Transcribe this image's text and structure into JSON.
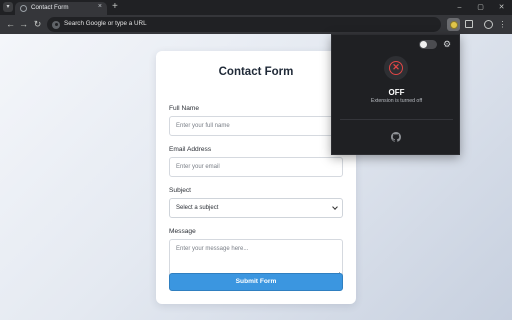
{
  "browser": {
    "tab_title": "Contact Form",
    "tab_close": "×",
    "new_tab": "+",
    "omnibox_placeholder": "Search Google or type a URL",
    "window_controls": {
      "minimize": "–",
      "maximize": "▢",
      "close": "✕"
    },
    "nav": {
      "back": "←",
      "forward": "→",
      "reload": "↻"
    },
    "menu": "⋮"
  },
  "form": {
    "title": "Contact Form",
    "full_name_label": "Full Name",
    "full_name_placeholder": "Enter your full name",
    "email_label": "Email Address",
    "email_placeholder": "Enter your email",
    "subject_label": "Subject",
    "subject_selected": "Select a subject",
    "message_label": "Message",
    "message_placeholder": "Enter your message here...",
    "submit_label": "Submit Form"
  },
  "extension_popup": {
    "enabled": false,
    "status": "OFF",
    "status_detail": "Extension is turned off",
    "status_icon": "✕",
    "gear_icon": "⚙",
    "status_color": "#e04646"
  },
  "colors": {
    "primary_button": "#3b96e0",
    "popup_bg": "#1f2023"
  }
}
